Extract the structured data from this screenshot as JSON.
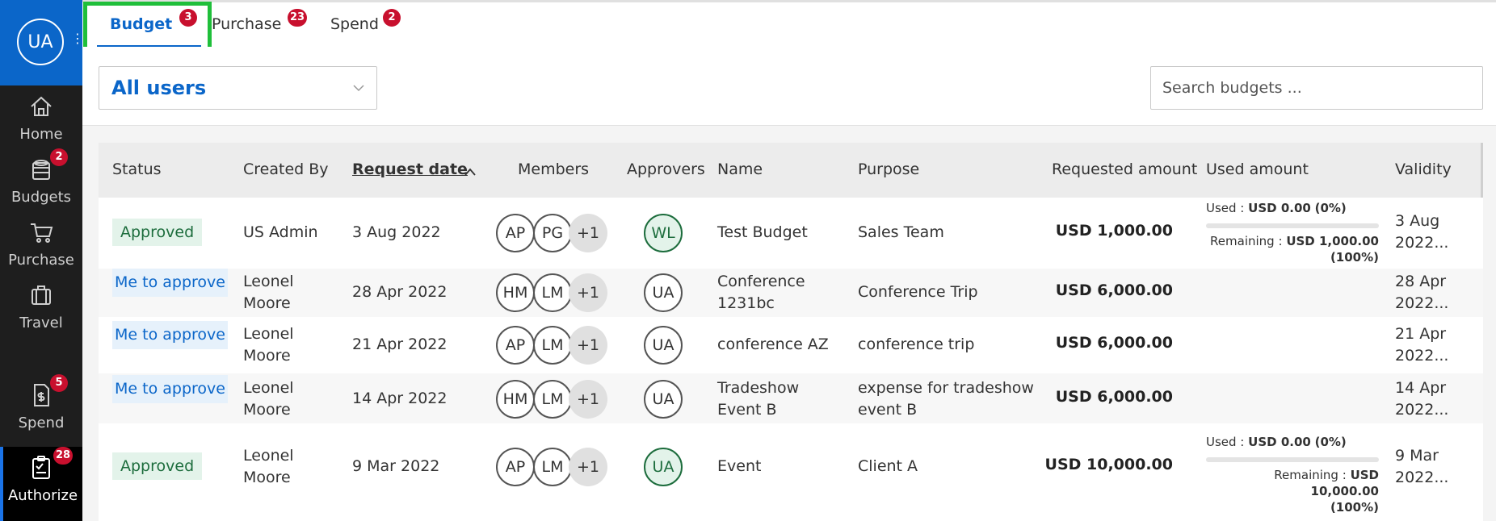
{
  "sidebar": {
    "avatar": "UA",
    "items": [
      {
        "label": "Home",
        "badge": null
      },
      {
        "label": "Budgets",
        "badge": "2"
      },
      {
        "label": "Purchase",
        "badge": null
      },
      {
        "label": "Travel",
        "badge": null
      },
      {
        "label": "Spend",
        "badge": "5"
      },
      {
        "label": "Authorize",
        "badge": "28"
      }
    ]
  },
  "tabs": [
    {
      "label": "Budget",
      "badge": "3"
    },
    {
      "label": "Purchase",
      "badge": "23"
    },
    {
      "label": "Spend",
      "badge": "2"
    }
  ],
  "filter": {
    "selected_user": "All users",
    "search_placeholder": "Search budgets ..."
  },
  "table": {
    "columns": [
      "Status",
      "Created By",
      "Request date",
      "Members",
      "Approvers",
      "Name",
      "Purpose",
      "Requested amount",
      "Used amount",
      "Validity"
    ],
    "rows": [
      {
        "status": "Approved",
        "created_by": "US Admin",
        "request_date": "3 Aug 2022",
        "members": [
          "AP",
          "PG",
          "+1"
        ],
        "approver": "WL",
        "name": "Test Budget",
        "purpose": "Sales Team",
        "amount": "USD 1,000.00",
        "used": {
          "used_label": "Used :",
          "used_value": "USD 0.00",
          "used_pct": "(0%)",
          "remaining_label": "Remaining :",
          "remaining_value": "USD 1,000.00",
          "remaining_pct": "(100%)"
        },
        "validity": [
          "3 Aug",
          "2022..."
        ]
      },
      {
        "status": "Me to approve",
        "created_by": "Leonel Moore",
        "request_date": "28 Apr 2022",
        "members": [
          "HM",
          "LM",
          "+1"
        ],
        "approver": "UA",
        "name": "Conference 1231bc",
        "purpose": "Conference Trip",
        "amount": "USD 6,000.00",
        "used": null,
        "validity": [
          "28 Apr",
          "2022..."
        ]
      },
      {
        "status": "Me to approve",
        "created_by": "Leonel Moore",
        "request_date": "21 Apr 2022",
        "members": [
          "AP",
          "LM",
          "+1"
        ],
        "approver": "UA",
        "name": "conference AZ",
        "purpose": "conference trip",
        "amount": "USD 6,000.00",
        "used": null,
        "validity": [
          "21 Apr",
          "2022..."
        ]
      },
      {
        "status": "Me to approve",
        "created_by": "Leonel Moore",
        "request_date": "14 Apr 2022",
        "members": [
          "HM",
          "LM",
          "+1"
        ],
        "approver": "UA",
        "name": "Tradeshow Event B",
        "purpose": "expense for tradeshow event B",
        "amount": "USD 6,000.00",
        "used": null,
        "validity": [
          "14 Apr",
          "2022..."
        ]
      },
      {
        "status": "Approved",
        "created_by": "Leonel Moore",
        "request_date": "9 Mar 2022",
        "members": [
          "AP",
          "LM",
          "+1"
        ],
        "approver": "UA",
        "name": "Event",
        "purpose": "Client A",
        "amount": "USD 10,000.00",
        "used": {
          "used_label": "Used :",
          "used_value": "USD 0.00",
          "used_pct": "(0%)",
          "remaining_label": "Remaining :",
          "remaining_value": "USD 10,000.00",
          "remaining_pct": "(100%)"
        },
        "validity": [
          "9 Mar",
          "2022..."
        ]
      }
    ]
  }
}
